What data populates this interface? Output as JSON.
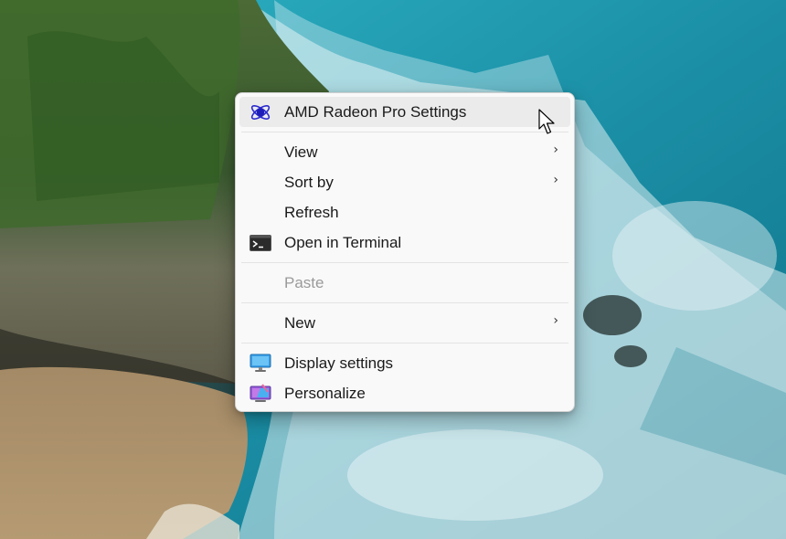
{
  "menu": {
    "items": [
      {
        "label": "AMD Radeon Pro Settings",
        "icon": "amd-radeon-icon"
      },
      {
        "label": "View",
        "submenu": true
      },
      {
        "label": "Sort by",
        "submenu": true
      },
      {
        "label": "Refresh"
      },
      {
        "label": "Open in Terminal",
        "icon": "terminal-icon"
      },
      {
        "label": "Paste",
        "disabled": true
      },
      {
        "label": "New",
        "submenu": true
      },
      {
        "label": "Display settings",
        "icon": "monitor-icon"
      },
      {
        "label": "Personalize",
        "icon": "personalize-icon"
      }
    ],
    "chevron": "›"
  },
  "colors": {
    "menu_bg": "#f9f9f9",
    "hover_bg": "#ebebeb",
    "text": "#1a1a1a",
    "disabled_text": "#9a9a9a",
    "amd_icon": "#2a2ad0"
  }
}
